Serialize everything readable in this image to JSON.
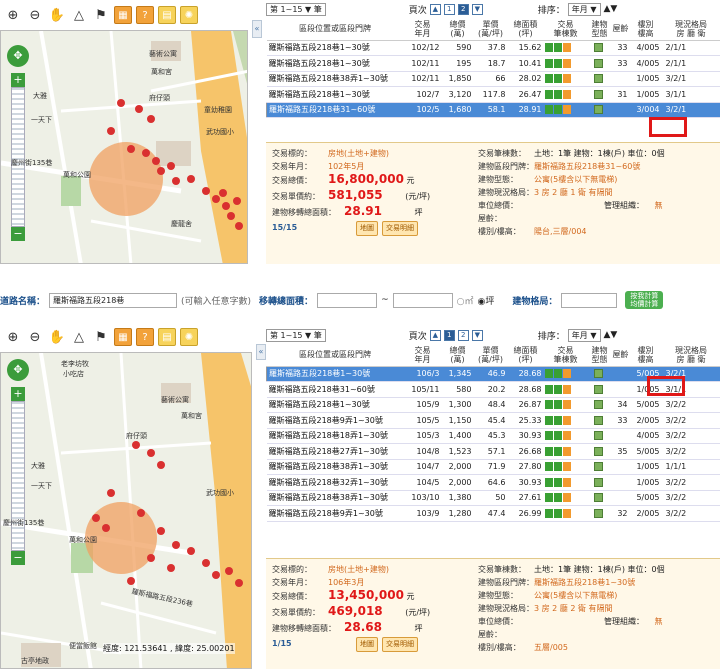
{
  "panel1": {
    "map": {
      "labels": [
        "藝術公寓",
        "萬和宮",
        "慶州街135巷",
        "萬和公園",
        "府仔頭",
        "一天下",
        "大雅",
        "武功國小",
        "童幼稚園",
        "慶龍舍"
      ]
    },
    "topbar": {
      "range": "第 1~15 ▼ 筆",
      "pages_label": "頁次",
      "pages": [
        "1",
        "2"
      ],
      "current_page": "2",
      "sort_label": "排序：",
      "sort_value": "年月 ▼",
      "sort_arrows": "▲▼"
    },
    "headers": [
      "區段位置或區段門牌",
      "交易\n年月",
      "總價\n(萬)",
      "單價\n(萬/坪)",
      "總面積\n(坪)",
      "交易\n筆棟數",
      "建物\n型態",
      "屋齡",
      "樓別\n樓高",
      "現況格局\n房 廳 衛"
    ],
    "rows": [
      {
        "addr": "羅斯福路五段218巷1~30號",
        "ym": "102/12",
        "total": "590",
        "unit": "37.8",
        "area": "15.62",
        "type": "",
        "age": "33",
        "floor": "4/005",
        "layout": "2/1/1",
        "selected": false
      },
      {
        "addr": "羅斯福路五段218巷1~30號",
        "ym": "102/11",
        "total": "195",
        "unit": "18.7",
        "area": "10.41",
        "type": "",
        "age": "33",
        "floor": "4/005",
        "layout": "2/1/1",
        "selected": false
      },
      {
        "addr": "羅斯福路五段218巷38弄1~30號",
        "ym": "102/11",
        "total": "1,850",
        "unit": "66",
        "area": "28.02",
        "type": "",
        "age": "",
        "floor": "1/005",
        "layout": "3/2/1",
        "selected": false
      },
      {
        "addr": "羅斯福路五段218巷1~30號",
        "ym": "102/7",
        "total": "3,120",
        "unit": "117.8",
        "area": "26.47",
        "type": "",
        "age": "31",
        "floor": "1/005",
        "layout": "3/1/1",
        "selected": false
      },
      {
        "addr": "羅斯福路五段218巷31~60號",
        "ym": "102/5",
        "total": "1,680",
        "unit": "58.1",
        "area": "28.91",
        "type": "",
        "age": "",
        "floor": "3/004",
        "layout": "3/2/1",
        "selected": true
      }
    ],
    "detail": {
      "k_target": "交易標的：",
      "v_target": "房地(土地+建物)",
      "k_ym": "交易年月：",
      "v_ym": "102年5月",
      "k_total": "交易總價：",
      "v_total": "16,800,000",
      "u_total": "元",
      "k_unit": "交易單價約：",
      "v_unit": "581,055",
      "u_unit": "(元/坪)",
      "k_area": "建物移轉總面積：",
      "v_area": "28.91",
      "u_area": "坪",
      "count": "15/15",
      "btn_map": "地圖",
      "btn_detail": "交易明細",
      "k_cnt": "交易筆棟數：",
      "v_cnt": "土地：1筆 建物：1棟(戶) 車位：0個",
      "k_addr": "建物區段門牌：",
      "v_addr": "羅斯福路五段218巷31~60號",
      "k_type": "建物型態：",
      "v_type": "公寓(5樓含以下無電梯)",
      "k_layout": "建物現況格局：",
      "v_layout": "3 房 2 廳 1 衛 有隔間",
      "k_park": "車位總價：",
      "k_mgmt": "管理組織：",
      "v_mgmt": "無",
      "k_age": "屋齡：",
      "k_floor": "樓別/樓高：",
      "v_floor": "陽台,三層/004"
    }
  },
  "searchbar": {
    "road_label": "道路名稱：",
    "road_value": "羅斯福路五段218巷",
    "road_hint": "(可輸入任意字數)",
    "area_label": "移轉總面積：",
    "unit1": "○㎡",
    "unit2": "◉坪",
    "layout_label": "建物格局：",
    "calc_btn": "按我計算\n均價計算"
  },
  "panel2": {
    "map": {
      "labels": [
        "老李坊牧",
        "小吃店",
        "藝術公寓",
        "萬和宮",
        "慶州街135巷",
        "萬和公園",
        "武功國小",
        "一天下",
        "大雅",
        "府仔頭",
        "便當飯館",
        "古亭地政",
        "羅斯福路五段236巷"
      ],
      "coord_text": "經度: 121.53641 , 緯度: 25.00201"
    },
    "topbar": {
      "range": "第 1~15 ▼ 筆",
      "pages_label": "頁次",
      "pages": [
        "1",
        "2"
      ],
      "current_page": "1",
      "sort_label": "排序：",
      "sort_value": "年月 ▼",
      "sort_arrows": "▲▼"
    },
    "headers": [
      "區段位置或區段門牌",
      "交易\n年月",
      "總價\n(萬)",
      "單價\n(萬/坪)",
      "總面積\n(坪)",
      "交易\n筆棟數",
      "建物\n型態",
      "屋齡",
      "樓別\n樓高",
      "現況格局\n房 廳 衛"
    ],
    "rows": [
      {
        "addr": "羅斯福路五段218巷1~30號",
        "ym": "106/3",
        "total": "1,345",
        "unit": "46.9",
        "area": "28.68",
        "type": "",
        "age": "",
        "floor": "5/005",
        "layout": "3/2/1",
        "selected": true
      },
      {
        "addr": "羅斯福路五段218巷31~60號",
        "ym": "105/11",
        "total": "580",
        "unit": "20.2",
        "area": "28.68",
        "type": "",
        "age": "",
        "floor": "1/005",
        "layout": "3/1/1",
        "selected": false
      },
      {
        "addr": "羅斯福路五段218巷1~30號",
        "ym": "105/9",
        "total": "1,300",
        "unit": "48.4",
        "area": "26.87",
        "type": "",
        "age": "34",
        "floor": "5/005",
        "layout": "3/2/2",
        "selected": false
      },
      {
        "addr": "羅斯福路五段218巷9弄1~30號",
        "ym": "105/5",
        "total": "1,150",
        "unit": "45.4",
        "area": "25.33",
        "type": "",
        "age": "33",
        "floor": "2/005",
        "layout": "3/2/2",
        "selected": false
      },
      {
        "addr": "羅斯福路五段218巷18弄1~30號",
        "ym": "105/3",
        "total": "1,400",
        "unit": "45.3",
        "area": "30.93",
        "type": "",
        "age": "",
        "floor": "4/005",
        "layout": "3/2/2",
        "selected": false
      },
      {
        "addr": "羅斯福路五段218巷27弄1~30號",
        "ym": "104/8",
        "total": "1,523",
        "unit": "57.1",
        "area": "26.68",
        "type": "",
        "age": "35",
        "floor": "5/005",
        "layout": "3/2/2",
        "selected": false
      },
      {
        "addr": "羅斯福路五段218巷38弄1~30號",
        "ym": "104/7",
        "total": "2,000",
        "unit": "71.9",
        "area": "27.80",
        "type": "",
        "age": "",
        "floor": "1/005",
        "layout": "1/1/1",
        "selected": false
      },
      {
        "addr": "羅斯福路五段218巷32弄1~30號",
        "ym": "104/5",
        "total": "2,000",
        "unit": "64.6",
        "area": "30.93",
        "type": "",
        "age": "",
        "floor": "1/005",
        "layout": "3/2/2",
        "selected": false
      },
      {
        "addr": "羅斯福路五段218巷38弄1~30號",
        "ym": "103/10",
        "total": "1,380",
        "unit": "50",
        "area": "27.61",
        "type": "",
        "age": "",
        "floor": "5/005",
        "layout": "3/2/2",
        "selected": false
      },
      {
        "addr": "羅斯福路五段218巷9弄1~30號",
        "ym": "103/9",
        "total": "1,280",
        "unit": "47.4",
        "area": "26.99",
        "type": "",
        "age": "32",
        "floor": "2/005",
        "layout": "3/2/2",
        "selected": false
      }
    ],
    "detail": {
      "k_target": "交易標的：",
      "v_target": "房地(土地+建物)",
      "k_ym": "交易年月：",
      "v_ym": "106年3月",
      "k_total": "交易總價：",
      "v_total": "13,450,000",
      "u_total": "元",
      "k_unit": "交易單價約：",
      "v_unit": "469,018",
      "u_unit": "(元/坪)",
      "k_area": "建物移轉總面積：",
      "v_area": "28.68",
      "u_area": "坪",
      "count": "1/15",
      "btn_map": "地圖",
      "btn_detail": "交易明細",
      "k_cnt": "交易筆棟數：",
      "v_cnt": "土地：1筆 建物：1棟(戶) 車位：0個",
      "k_addr": "建物區段門牌：",
      "v_addr": "羅斯福路五段218巷1~30號",
      "k_type": "建物型態：",
      "v_type": "公寓(5樓含以下無電梯)",
      "k_layout": "建物現況格局：",
      "v_layout": "3 房 2 廳 2 衛 有隔間",
      "k_park": "車位總價：",
      "k_mgmt": "管理組織：",
      "v_mgmt": "無",
      "k_age": "屋齡：",
      "k_floor": "樓別/樓高：",
      "v_floor": "五層/005"
    }
  },
  "colors": {
    "selected_row": "#4a8ad6",
    "highlight_box": "#e01818",
    "buffer_circle": "#f0a060",
    "marker": "#d93030",
    "road_main": "#f6c46a"
  }
}
